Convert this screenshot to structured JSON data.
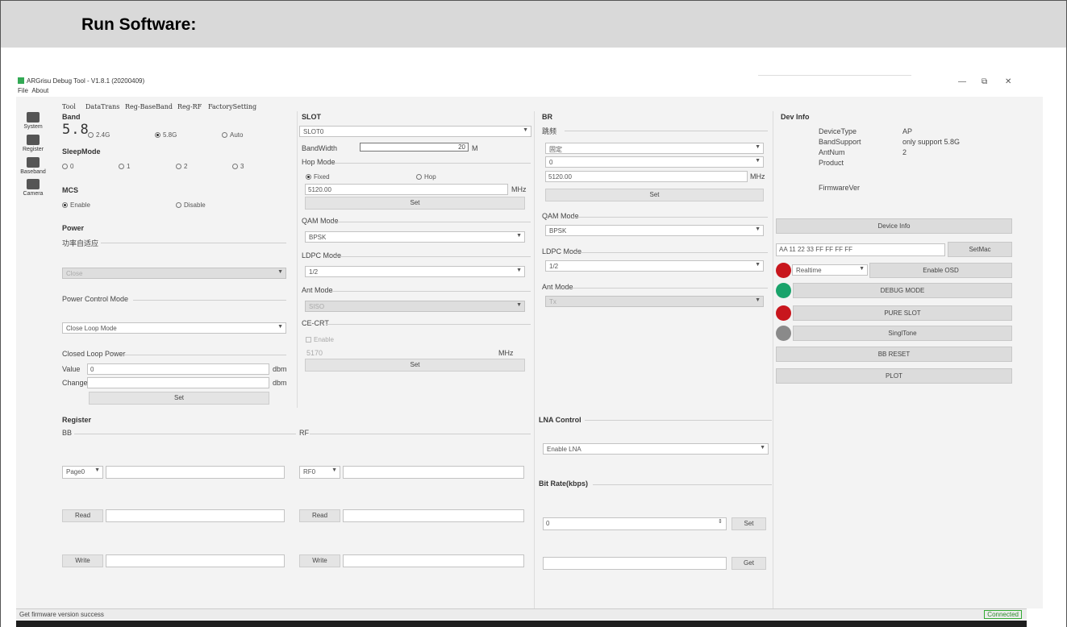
{
  "doc": {
    "heading": "Run Software:"
  },
  "window": {
    "title": "ARGrisu Debug Tool - V1.8.1 (20200409)",
    "menu": [
      "File",
      "About"
    ],
    "controls": {
      "min": "—",
      "max": "⧉",
      "close": "✕"
    }
  },
  "tabs": [
    "Tool",
    "DataTrans",
    "Reg-BaseBand",
    "Reg-RF",
    "FactorySetting"
  ],
  "sidebar": [
    "System",
    "Register",
    "Baseband",
    "Camera"
  ],
  "band": {
    "title": "Band",
    "indicator": "5.8",
    "options": [
      "2.4G",
      "5.8G",
      "Auto"
    ],
    "selected": "5.8G"
  },
  "sleep": {
    "title": "SleepMode",
    "options": [
      "0",
      "1",
      "2",
      "3"
    ]
  },
  "mcs": {
    "title": "MCS",
    "options": [
      "Enable",
      "Disable"
    ],
    "selected": "Enable"
  },
  "power": {
    "title": "Power",
    "adaptive_label": "功率自适应",
    "adaptive_value": "Close",
    "control_mode_label": "Power Control Mode",
    "control_mode_value": "Close Loop Mode",
    "closed_loop_label": "Closed Loop Power",
    "value_label": "Value",
    "value": "0",
    "value_unit": "dbm",
    "change_label": "Change",
    "change_unit": "dbm",
    "set": "Set"
  },
  "slot": {
    "title": "SLOT",
    "slot_value": "SLOT0",
    "bw_label": "BandWidth",
    "bw_value": "20",
    "bw_unit": "M",
    "hop_label": "Hop Mode",
    "hop_options": [
      "Fixed",
      "Hop"
    ],
    "hop_selected": "Fixed",
    "freq": "5120.00",
    "freq_unit": "MHz",
    "set": "Set",
    "qam_label": "QAM Mode",
    "qam_value": "BPSK",
    "ldpc_label": "LDPC Mode",
    "ldpc_value": "1/2",
    "ant_label": "Ant Mode",
    "ant_value": "SISO",
    "cecrt_label": "CE-CRT",
    "enable": "Enable",
    "cecrt_freq": "5170",
    "cecrt_unit": "MHz",
    "set2": "Set"
  },
  "br": {
    "title": "BR",
    "hop_label": "跳频",
    "hop_value": "固定",
    "second_value": "0",
    "freq": "5120.00",
    "freq_unit": "MHz",
    "set": "Set",
    "qam_label": "QAM Mode",
    "qam_value": "BPSK",
    "ldpc_label": "LDPC Mode",
    "ldpc_value": "1/2",
    "ant_label": "Ant Mode",
    "ant_value": "Tx"
  },
  "devinfo": {
    "title": "Dev Info",
    "rows": [
      {
        "k": "DeviceType",
        "v": "AP"
      },
      {
        "k": "BandSupport",
        "v": "only support 5.8G"
      },
      {
        "k": "AntNum",
        "v": "2"
      },
      {
        "k": "Product",
        "v": ""
      },
      {
        "k": "FirmwareVer",
        "v": ""
      }
    ],
    "device_info_btn": "Device Info",
    "mac": "AA 11 22 33 FF FF FF FF",
    "setmac": "SetMac",
    "realtime": "Realtime",
    "enable_osd": "Enable OSD",
    "debug_mode": "DEBUG MODE",
    "pure_slot": "PURE SLOT",
    "singletone": "SinglTone",
    "bb_reset": "BB RESET",
    "plot": "PLOT"
  },
  "register": {
    "title": "Register",
    "bb_label": "BB",
    "rf_label": "RF",
    "bb_page": "Page0",
    "rf_page": "RF0",
    "read": "Read",
    "write": "Write"
  },
  "lna": {
    "title": "LNA Control",
    "value": "Enable LNA"
  },
  "bitrate": {
    "title": "Bit Rate(kbps)",
    "value": "0",
    "set": "Set",
    "get": "Get"
  },
  "status": {
    "text": "Get firmware version success",
    "connected": "Connected"
  },
  "colors": {
    "red": "#c8161d",
    "green": "#1aa36b",
    "gray": "#8a8a8a"
  }
}
